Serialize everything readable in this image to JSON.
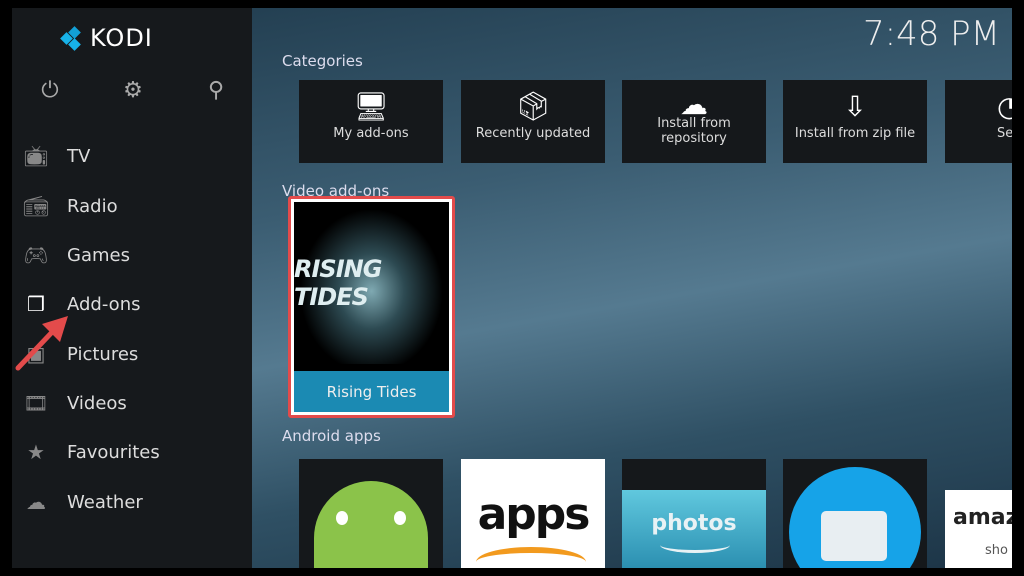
{
  "app": {
    "name": "KODI",
    "clock": "7:48 PM"
  },
  "topbar": {
    "icons": [
      "power-icon",
      "gear-icon",
      "search-icon"
    ]
  },
  "sidebar": {
    "items": [
      {
        "label": "TV",
        "icon": "tv-icon"
      },
      {
        "label": "Radio",
        "icon": "radio-icon"
      },
      {
        "label": "Games",
        "icon": "gamepad-icon"
      },
      {
        "label": "Add-ons",
        "icon": "addons-box-icon",
        "active": true
      },
      {
        "label": "Pictures",
        "icon": "picture-icon"
      },
      {
        "label": "Videos",
        "icon": "film-icon"
      },
      {
        "label": "Favourites",
        "icon": "star-icon"
      },
      {
        "label": "Weather",
        "icon": "weather-icon"
      }
    ]
  },
  "sections": {
    "categories": {
      "title": "Categories",
      "tiles": [
        {
          "label": "My add-ons",
          "icon": "monitor-box-icon"
        },
        {
          "label": "Recently updated",
          "icon": "open-box-icon"
        },
        {
          "label": "Install from repository",
          "icon": "cloud-download-icon"
        },
        {
          "label": "Install from zip file",
          "icon": "zip-download-icon"
        },
        {
          "label": "Se",
          "icon": "search-icon"
        }
      ]
    },
    "video": {
      "title": "Video add-ons",
      "items": [
        {
          "label": "Rising Tides",
          "poster_text": "RISING TIDES"
        }
      ]
    },
    "android": {
      "title": "Android apps",
      "items": [
        {
          "label": "android",
          "icon": "android-icon"
        },
        {
          "label": "apps"
        },
        {
          "label": "photos"
        },
        {
          "label": "files",
          "icon": "folder-icon"
        },
        {
          "label": "amaz",
          "sub": "sho"
        }
      ]
    }
  },
  "annotation": {
    "arrow_color": "#e34b4b",
    "highlight_color": "#e34b4b"
  },
  "colors": {
    "accent": "#17b2e8",
    "selected_bar": "#1b8ab3"
  }
}
